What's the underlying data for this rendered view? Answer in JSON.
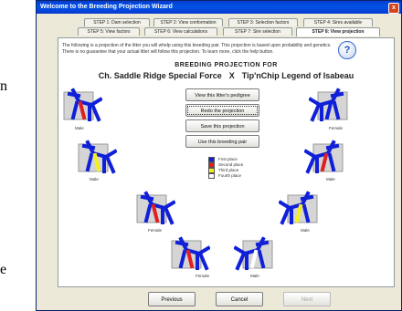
{
  "window": {
    "title": "Welcome to the Breeding Projection Wizard",
    "close_glyph": "x"
  },
  "side_text": {
    "top": "n",
    "bottom": "e"
  },
  "tabs_row1": [
    {
      "label": "STEP 1: Dam selection"
    },
    {
      "label": "STEP 2: View conformation"
    },
    {
      "label": "STEP 3: Selection factors"
    },
    {
      "label": "STEP 4: Sires available"
    }
  ],
  "tabs_row2": [
    {
      "label": "STEP 5: View factors"
    },
    {
      "label": "STEP 6: View calculations"
    },
    {
      "label": "STEP 7: Sire selection"
    },
    {
      "label": "STEP 8: View projection"
    }
  ],
  "intro_text": "The following is a projection of the litter you will whelp using this breeding pair. This projection is based upon probability and genetics. There is no guarantee that your actual litter will follow this projection. To learn more, click the help button.",
  "help_glyph": "?",
  "heading": "BREEDING PROJECTION FOR",
  "parents": {
    "dam": "Ch. Saddle Ridge Special Force",
    "x": "X",
    "sire": "Tip'nChip Legend of Isabeau"
  },
  "action_buttons": [
    {
      "label": "View this litter's pedigree"
    },
    {
      "label": "Redo the projection"
    },
    {
      "label": "Save this projection"
    },
    {
      "label": "Use this breeding pair"
    }
  ],
  "legend": [
    {
      "label": "First place",
      "color": "#1020d8"
    },
    {
      "label": "Second place",
      "color": "#e02020"
    },
    {
      "label": "Third place",
      "color": "#f4f020"
    },
    {
      "label": "Fourth place",
      "color": "#ffffff"
    }
  ],
  "pups": [
    {
      "sex": "Male",
      "mark": "red",
      "body": "#1020d8",
      "accent": "#e02020"
    },
    {
      "sex": "Female",
      "mark": "none",
      "body": "#1020d8",
      "accent": "#1020d8"
    },
    {
      "sex": "Male",
      "mark": "yellow",
      "body": "#1020d8",
      "accent": "#f4f020"
    },
    {
      "sex": "Male",
      "mark": "red",
      "body": "#1020d8",
      "accent": "#e02020"
    },
    {
      "sex": "Female",
      "mark": "red",
      "body": "#1020d8",
      "accent": "#e02020"
    },
    {
      "sex": "Male",
      "mark": "yellow",
      "body": "#1020d8",
      "accent": "#f4f020"
    },
    {
      "sex": "Female",
      "mark": "red",
      "body": "#1020d8",
      "accent": "#e02020"
    },
    {
      "sex": "Male",
      "mark": "white",
      "body": "#1020d8",
      "accent": "#ffffff"
    }
  ],
  "bottom_buttons": {
    "previous": "Previous",
    "cancel": "Cancel",
    "next": "Next"
  }
}
